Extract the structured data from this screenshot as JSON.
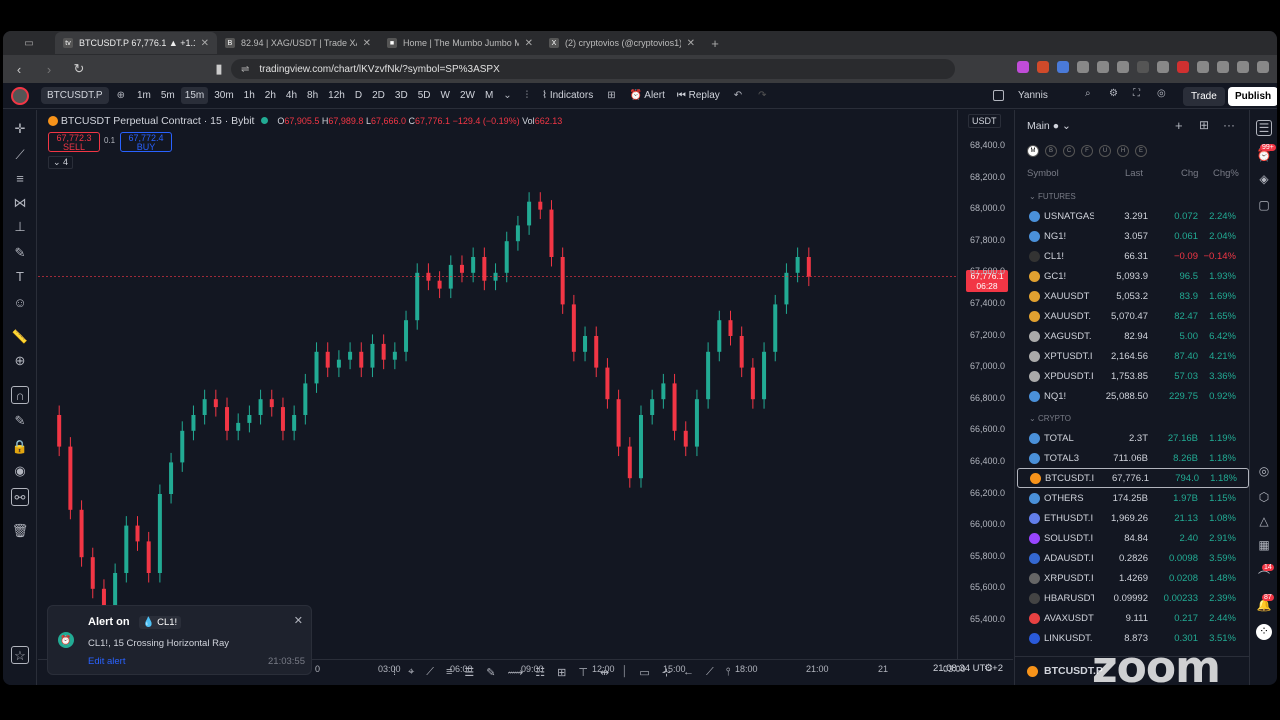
{
  "browser": {
    "tabs": [
      {
        "title": "BTCUSDT.P 67,776.1 ▲ +1.19% …",
        "active": true,
        "fav": "tv"
      },
      {
        "title": "82.94 | XAG/USDT | Trade XAG/US…",
        "active": false,
        "fav": "B"
      },
      {
        "title": "Home | The Mumbo Jumbo Market…",
        "active": false,
        "fav": "■"
      },
      {
        "title": "(2) cryptovios (@cryptovios1) / X",
        "active": false,
        "fav": "X"
      }
    ],
    "url": "tradingview.com/chart/lKVzvfNk/?symbol=SP%3ASPX"
  },
  "toolbar": {
    "symbol": "BTCUSDT.P",
    "timeframes": [
      "1m",
      "5m",
      "15m",
      "30m",
      "1h",
      "2h",
      "4h",
      "8h",
      "12h",
      "D",
      "2D",
      "3D",
      "5D",
      "W",
      "2W",
      "M"
    ],
    "selected_tf": "15m",
    "indicators": "Indicators",
    "alert": "Alert",
    "replay": "Replay",
    "user": "Yannis",
    "trade": "Trade",
    "publish": "Publish"
  },
  "chart": {
    "title": "BTCUSDT Perpetual Contract · 15 · Bybit",
    "o": "O",
    "o_val": "67,905.5",
    "h": "H",
    "h_val": "67,989.8",
    "l": "L",
    "l_val": "67,666.0",
    "c": "C",
    "c_val": "67,776.1",
    "chg": "−129.4 (−0.19%)",
    "vol": "Vol",
    "vol_val": "662.13",
    "sell_price": "67,772.3",
    "sell": "SELL",
    "buy_price": "67,772.4",
    "buy": "BUY",
    "spread": "0.1",
    "collapse": "4",
    "currency": "USDT",
    "current_price": "67,776.1",
    "countdown": "06:28",
    "y_labels": [
      "68,400.0",
      "68,200.0",
      "68,000.0",
      "67,800.0",
      "67,600.0",
      "67,400.0",
      "67,200.0",
      "67,000.0",
      "66,800.0",
      "66,600.0",
      "66,400.0",
      "66,200.0",
      "66,000.0",
      "65,800.0",
      "65,600.0",
      "65,400.0"
    ],
    "x_labels": [
      "0",
      "03:00",
      "06:00",
      "09:00",
      "12:00",
      "15:00",
      "18:00",
      "21:00",
      "21",
      "03:00"
    ],
    "time": "21:08:34 UTC+2",
    "colors": {
      "up": "#22ab94",
      "down": "#f23645",
      "bg": "#131722"
    }
  },
  "alert_toast": {
    "title": "Alert on",
    "symbol": "CL1!",
    "message": "CL1!, 15 Crossing Horizontal Ray",
    "link": "Edit alert",
    "time": "21:03:55"
  },
  "watchlist": {
    "title": "Main",
    "filters": [
      "M",
      "B",
      "C",
      "F",
      "U",
      "H",
      "E"
    ],
    "headers": {
      "symbol": "Symbol",
      "last": "Last",
      "chg": "Chg",
      "chgp": "Chg%"
    },
    "sections": [
      {
        "name": "FUTURES",
        "rows": [
          {
            "s": "USNATGAS",
            "l": "3.291",
            "c": "0.072",
            "p": "2.24%",
            "dir": "up",
            "col": "#4a90d9"
          },
          {
            "s": "NG1!",
            "l": "3.057",
            "c": "0.061",
            "p": "2.04%",
            "dir": "up",
            "col": "#4a90d9"
          },
          {
            "s": "CL1!",
            "l": "66.31",
            "c": "−0.09",
            "p": "−0.14%",
            "dir": "dn",
            "col": "#333"
          },
          {
            "s": "GC1!",
            "l": "5,093.9",
            "c": "96.5",
            "p": "1.93%",
            "dir": "up",
            "col": "#e0a030"
          },
          {
            "s": "XAUUSDT",
            "l": "5,053.2",
            "c": "83.9",
            "p": "1.69%",
            "dir": "up",
            "col": "#e0a030"
          },
          {
            "s": "XAUUSDT.",
            "l": "5,070.47",
            "c": "82.47",
            "p": "1.65%",
            "dir": "up",
            "col": "#e0a030"
          },
          {
            "s": "XAGUSDT.",
            "l": "82.94",
            "c": "5.00",
            "p": "6.42%",
            "dir": "up",
            "col": "#aaa"
          },
          {
            "s": "XPTUSDT.I",
            "l": "2,164.56",
            "c": "87.40",
            "p": "4.21%",
            "dir": "up",
            "col": "#aaa"
          },
          {
            "s": "XPDUSDT.I",
            "l": "1,753.85",
            "c": "57.03",
            "p": "3.36%",
            "dir": "up",
            "col": "#aaa"
          },
          {
            "s": "NQ1!",
            "l": "25,088.50",
            "c": "229.75",
            "p": "0.92%",
            "dir": "up",
            "col": "#4a90d9"
          }
        ]
      },
      {
        "name": "CRYPTO",
        "rows": [
          {
            "s": "TOTAL",
            "l": "2.3T",
            "c": "27.16B",
            "p": "1.19%",
            "dir": "up",
            "col": "#4a90d9"
          },
          {
            "s": "TOTAL3",
            "l": "711.06B",
            "c": "8.26B",
            "p": "1.18%",
            "dir": "up",
            "col": "#4a90d9"
          },
          {
            "s": "BTCUSDT.I",
            "l": "67,776.1",
            "c": "794.0",
            "p": "1.18%",
            "dir": "up",
            "col": "#f7931a"
          },
          {
            "s": "OTHERS",
            "l": "174.25B",
            "c": "1.97B",
            "p": "1.15%",
            "dir": "up",
            "col": "#4a90d9"
          },
          {
            "s": "ETHUSDT.I",
            "l": "1,969.26",
            "c": "21.13",
            "p": "1.08%",
            "dir": "up",
            "col": "#627eea"
          },
          {
            "s": "SOLUSDT.I",
            "l": "84.84",
            "c": "2.40",
            "p": "2.91%",
            "dir": "up",
            "col": "#9945ff"
          },
          {
            "s": "ADAUSDT.I",
            "l": "0.2826",
            "c": "0.0098",
            "p": "3.59%",
            "dir": "up",
            "col": "#3468d1"
          },
          {
            "s": "XRPUSDT.I",
            "l": "1.4269",
            "c": "0.0208",
            "p": "1.48%",
            "dir": "up",
            "col": "#666"
          },
          {
            "s": "HBARUSDT",
            "l": "0.09992",
            "c": "0.00233",
            "p": "2.39%",
            "dir": "up",
            "col": "#444"
          },
          {
            "s": "AVAXUSDT",
            "l": "9.111",
            "c": "0.217",
            "p": "2.44%",
            "dir": "up",
            "col": "#e84142"
          },
          {
            "s": "LINKUSDT.",
            "l": "8.873",
            "c": "0.301",
            "p": "3.51%",
            "dir": "up",
            "col": "#2a5ada"
          }
        ]
      }
    ],
    "footer_symbol": "BTCUSDT.P"
  },
  "badges": {
    "notif1": "99+",
    "notif2": "14",
    "notif3": "87"
  },
  "watermark": "zoom"
}
